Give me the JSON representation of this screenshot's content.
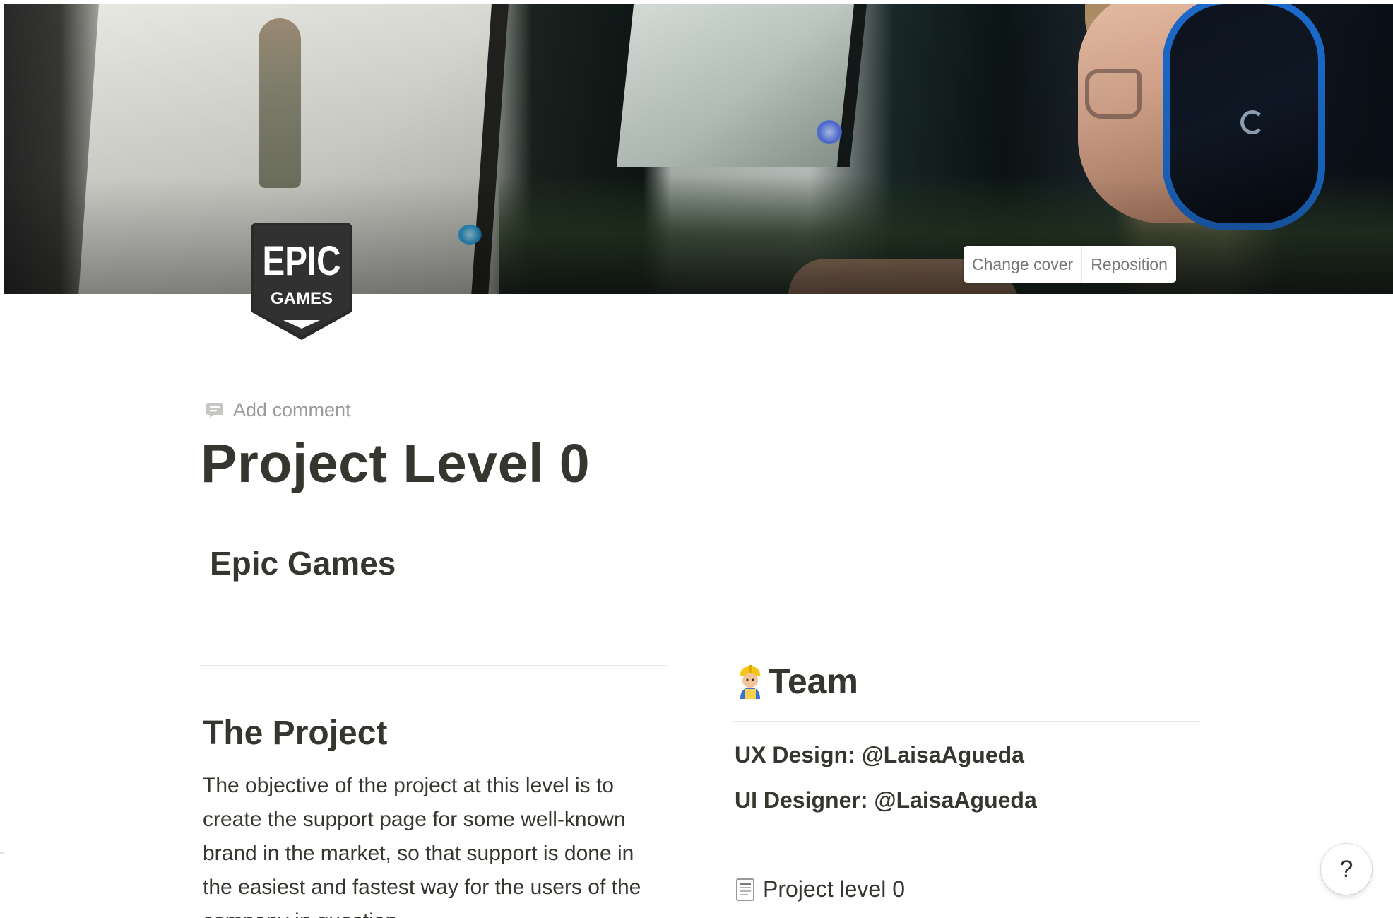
{
  "cover": {
    "change_cover_label": "Change cover",
    "reposition_label": "Reposition"
  },
  "page_icon": {
    "name": "epic-games-logo",
    "line1": "EPIC",
    "line2": "GAMES"
  },
  "add_comment_label": "Add comment",
  "title": "Project Level 0",
  "subtitle": "Epic Games",
  "project": {
    "heading": "The Project",
    "paragraph": "The objective of the project at this level is to create the support page for some well-known brand in the market, so that support is done in the easiest and fastest way for the users of the company in question."
  },
  "team": {
    "heading": "Team",
    "emoji": "construction-worker-icon",
    "members": [
      "UX Design: @LaisaAgueda",
      "UI Designer: @LaisaAgueda"
    ]
  },
  "subpage_link": "Project level 0",
  "help_label": "?",
  "colors": {
    "text": "#37352f",
    "muted": "#9b9a97",
    "divider": "#e9e9e7",
    "headset_accent": "#1d6fd4"
  }
}
